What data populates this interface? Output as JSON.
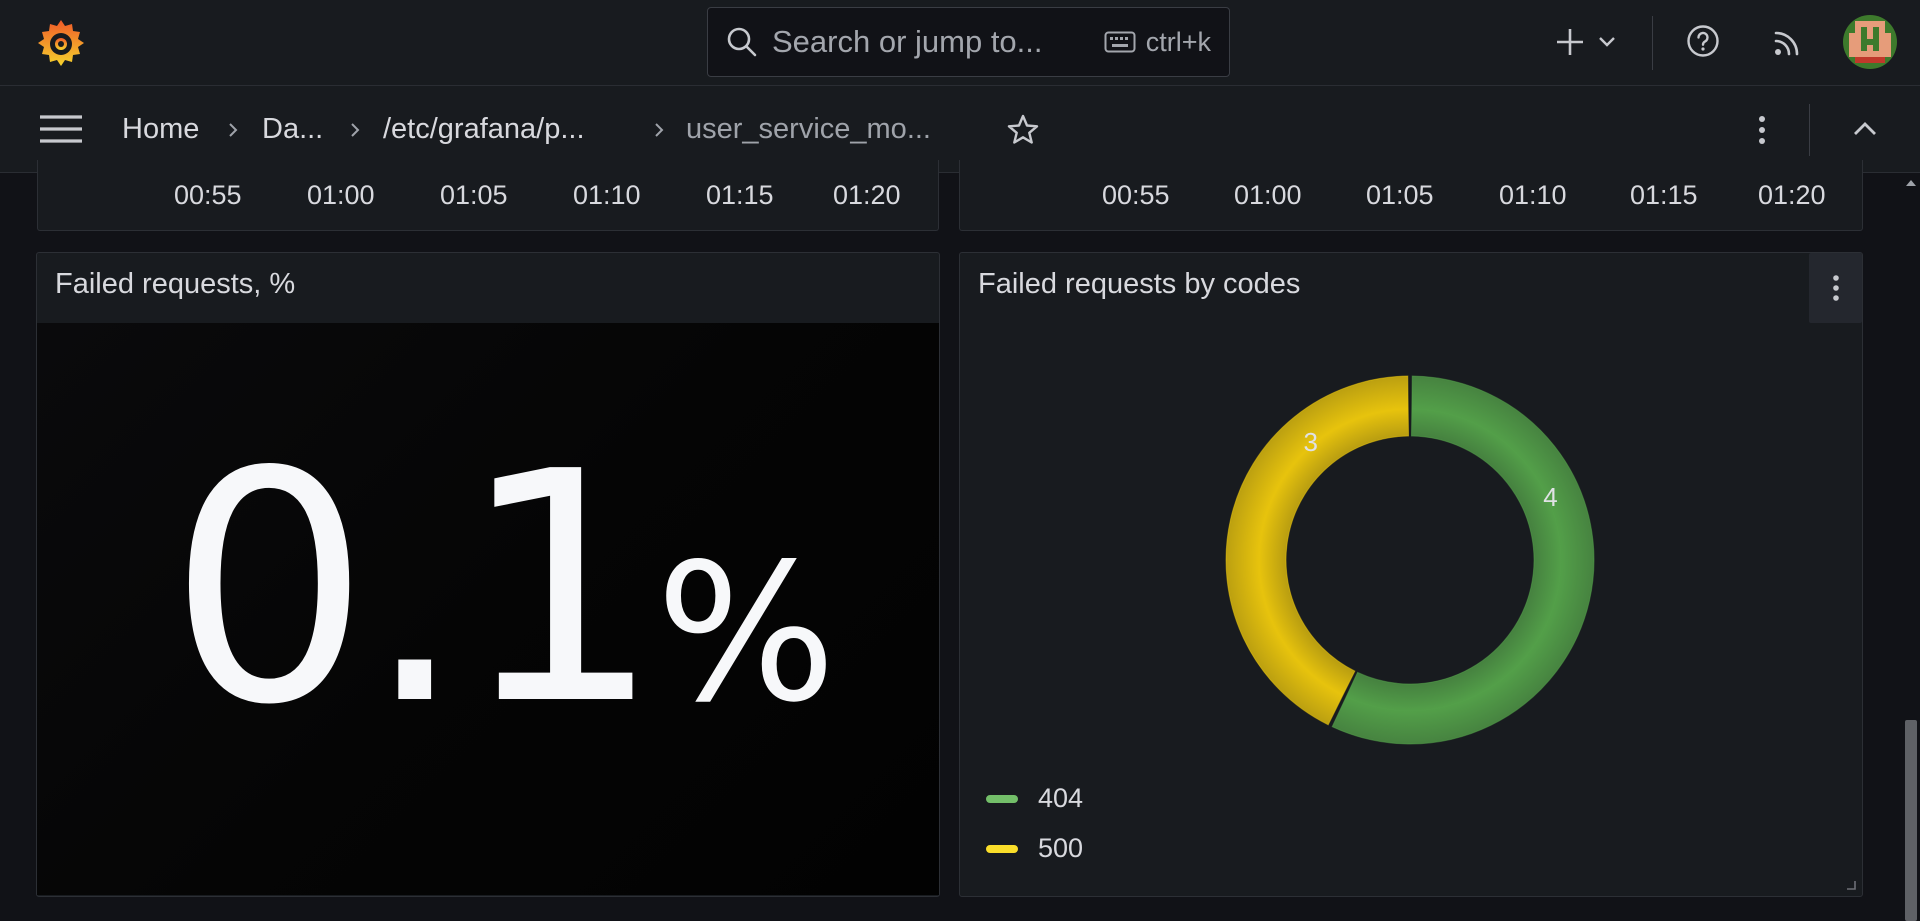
{
  "topbar": {
    "search_placeholder": "Search or jump to...",
    "search_shortcut": "ctrl+k",
    "icons": [
      "grafana-logo",
      "search-icon",
      "keyboard-icon",
      "plus-icon",
      "chevron-down-icon",
      "help-icon",
      "rss-icon",
      "avatar"
    ]
  },
  "breadcrumb": {
    "items": [
      "Home",
      "Da...",
      "/etc/grafana/p...",
      "user_service_mo..."
    ]
  },
  "time_axis": {
    "ticks": [
      "00:55",
      "01:00",
      "01:05",
      "01:10",
      "01:15",
      "01:20"
    ]
  },
  "panels": {
    "stat": {
      "title": "Failed requests, %",
      "value": "0.1",
      "unit": "%"
    },
    "donut": {
      "title": "Failed requests by codes"
    }
  },
  "chart_data": {
    "type": "pie",
    "donut": true,
    "series": [
      {
        "name": "404",
        "value": 4,
        "color": "#56a64b"
      },
      {
        "name": "500",
        "value": 3,
        "color": "#f2cc0c"
      }
    ],
    "legend_placement": "bottom-left"
  },
  "colors": {
    "background": "#111217",
    "panel": "#181b1f",
    "accent_404": "#73bf69",
    "accent_500": "#fade2a"
  }
}
